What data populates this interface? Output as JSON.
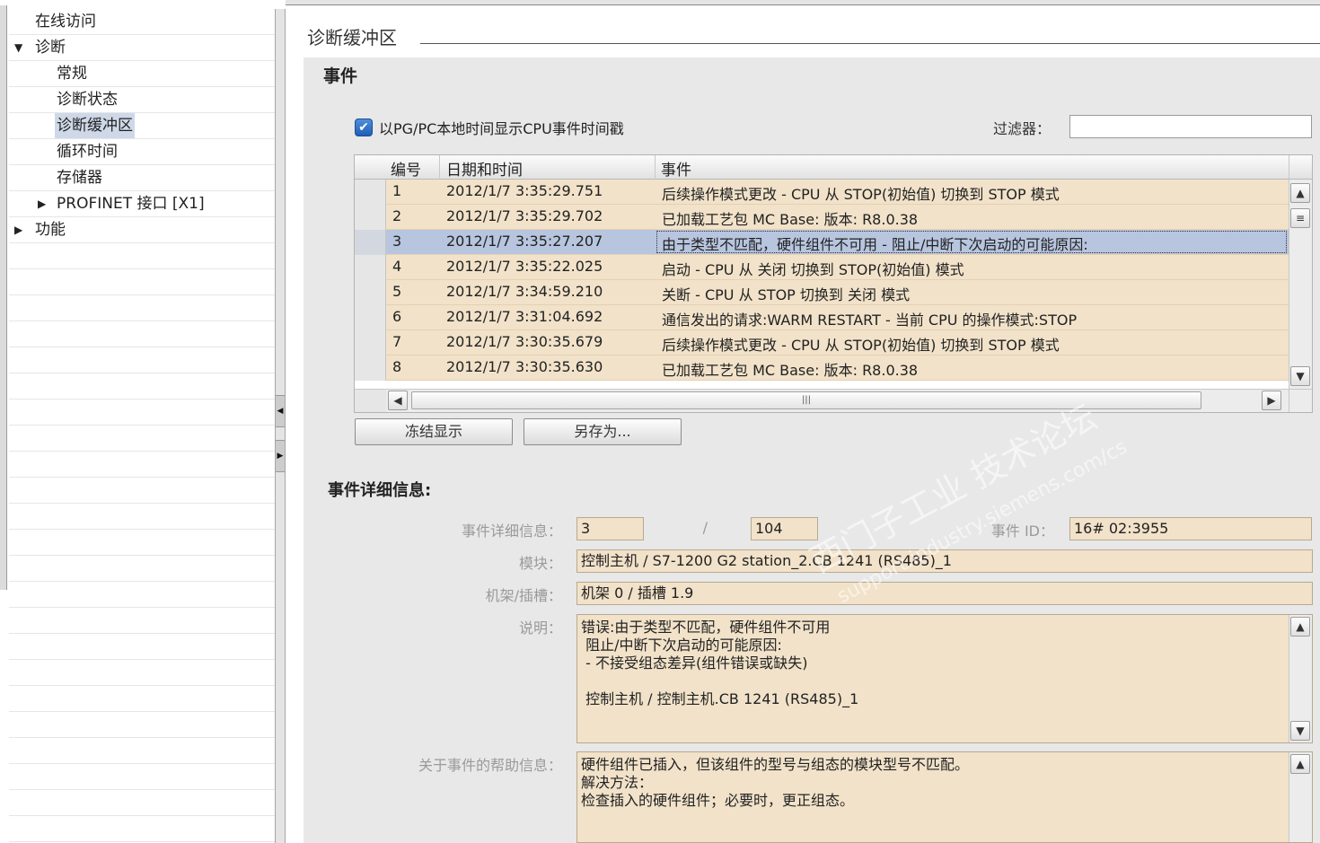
{
  "nav": {
    "items": [
      {
        "label": "在线访问",
        "level": 0,
        "arrow": ""
      },
      {
        "label": "诊断",
        "level": 0,
        "arrow": "▼"
      },
      {
        "label": "常规",
        "level": 1,
        "arrow": ""
      },
      {
        "label": "诊断状态",
        "level": 1,
        "arrow": ""
      },
      {
        "label": "诊断缓冲区",
        "level": 1,
        "arrow": "",
        "selected": true
      },
      {
        "label": "循环时间",
        "level": 1,
        "arrow": ""
      },
      {
        "label": "存储器",
        "level": 1,
        "arrow": ""
      },
      {
        "label": "PROFINET 接口 [X1]",
        "level": 1,
        "arrow": "▶"
      },
      {
        "label": "功能",
        "level": 0,
        "arrow": "▶"
      }
    ]
  },
  "main": {
    "title": "诊断缓冲区",
    "events_heading": "事件",
    "checkbox_label": "以PG/PC本地时间显示CPU事件时间戳",
    "checkbox_checked": true,
    "filter_label": "过滤器：",
    "filter_value": ""
  },
  "table": {
    "headers": {
      "num": "编号",
      "datetime": "日期和时间",
      "event": "事件"
    },
    "rows": [
      {
        "num": "1",
        "datetime": "2012/1/7 3:35:29.751",
        "event": "后续操作模式更改 - CPU 从 STOP(初始值) 切换到 STOP 模式"
      },
      {
        "num": "2",
        "datetime": "2012/1/7 3:35:29.702",
        "event": "已加载工艺包 MC Base: 版本: R8.0.38"
      },
      {
        "num": "3",
        "datetime": "2012/1/7 3:35:27.207",
        "event": "由于类型不匹配，硬件组件不可用 - 阻止/中断下次启动的可能原因:",
        "selected": true
      },
      {
        "num": "4",
        "datetime": "2012/1/7 3:35:22.025",
        "event": "启动 - CPU 从 关闭 切换到 STOP(初始值) 模式"
      },
      {
        "num": "5",
        "datetime": "2012/1/7 3:34:59.210",
        "event": "关断 - CPU 从 STOP 切换到 关闭 模式"
      },
      {
        "num": "6",
        "datetime": "2012/1/7 3:31:04.692",
        "event": "通信发出的请求:WARM RESTART - 当前 CPU 的操作模式:STOP"
      },
      {
        "num": "7",
        "datetime": "2012/1/7 3:30:35.679",
        "event": "后续操作模式更改 - CPU 从 STOP(初始值) 切换到 STOP 模式"
      },
      {
        "num": "8",
        "datetime": "2012/1/7 3:30:35.630",
        "event": "已加载工艺包 MC Base: 版本: R8.0.38"
      }
    ]
  },
  "buttons": {
    "freeze": "冻结显示",
    "save_as": "另存为..."
  },
  "details": {
    "heading": "事件详细信息:",
    "detail_label": "事件详细信息：",
    "detail_index": "3",
    "detail_sep": "/",
    "detail_total": "104",
    "event_id_label": "事件 ID：",
    "event_id": "16# 02:3955",
    "module_label": "模块：",
    "module": "控制主机 / S7-1200 G2 station_2.CB 1241 (RS485)_1",
    "rack_label": "机架/插槽：",
    "rack": "机架 0 / 插槽 1.9",
    "desc_label": "说明：",
    "desc_lines": [
      "错误:由于类型不匹配，硬件组件不可用",
      " 阻止/中断下次启动的可能原因:",
      " - 不接受组态差异(组件错误或缺失)",
      "",
      " 控制主机 / 控制主机.CB 1241 (RS485)_1"
    ],
    "help_label": "关于事件的帮助信息：",
    "help_lines": [
      "硬件组件已插入，但该组件的型号与组态的模块型号不匹配。",
      "解决方法：",
      "检查插入的硬件组件；必要时，更正组态。"
    ]
  },
  "watermark": {
    "line1": "西门子工业 技术论坛",
    "line2": "support.industry.siemens.com/cs"
  },
  "colors": {
    "row_bg": "#f1e2c9",
    "row_selected": "#b8c5df",
    "panel_bg": "#e8e8e8",
    "checkbox": "#2b6cc4"
  }
}
